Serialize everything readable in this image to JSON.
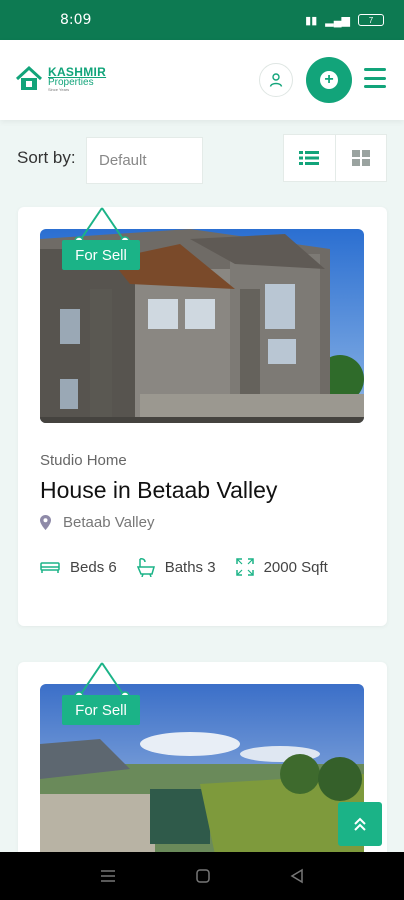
{
  "status_bar": {
    "time": "8:09",
    "battery": "7"
  },
  "header": {
    "logo_title": "KASHMIR",
    "logo_sub": "Properties",
    "logo_tag": "Since Years"
  },
  "controls": {
    "sort_label": "Sort by:",
    "sort_value": "Default"
  },
  "listings": [
    {
      "tag": "For Sell",
      "type": "Studio Home",
      "title": "House in Betaab Valley",
      "location": "Betaab Valley",
      "beds": "Beds 6",
      "baths": "Baths 3",
      "area": "2000 Sqft"
    },
    {
      "tag": "For Sell"
    }
  ],
  "colors": {
    "brand": "#12a47a",
    "status_bar": "#0d7a52",
    "tag": "#1bb387"
  },
  "icons": [
    "user-icon",
    "plus-icon",
    "menu-icon",
    "list-view-icon",
    "grid-view-icon",
    "location-pin-icon",
    "bed-icon",
    "bath-icon",
    "area-icon",
    "chevrons-up-icon"
  ]
}
